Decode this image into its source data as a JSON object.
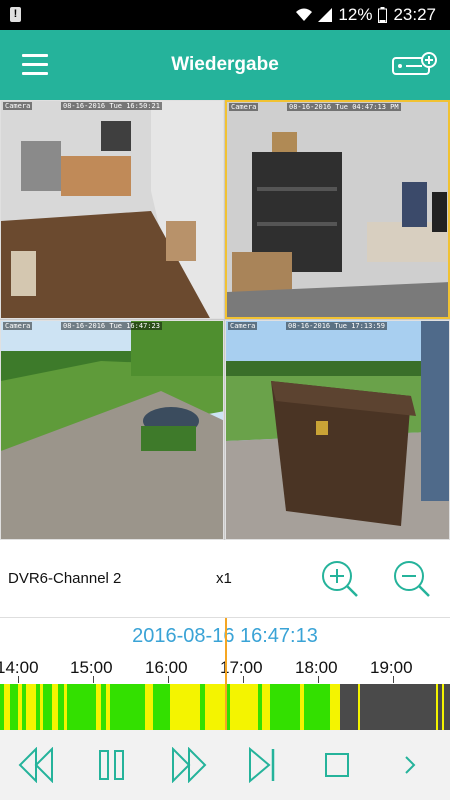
{
  "status_bar": {
    "battery": "12%",
    "time": "23:27"
  },
  "app_bar": {
    "title": "Wiedergabe"
  },
  "cameras": [
    {
      "name": "Camera",
      "timestamp": "08-16-2016 Tue 16:50:21"
    },
    {
      "name": "Camera",
      "timestamp": "08-16-2016 Tue 04:47:13 PM"
    },
    {
      "name": "Camera",
      "timestamp": "08-16-2016 Tue 16:47:23"
    },
    {
      "name": "Camera",
      "timestamp": "08-16-2016 Tue 17:13:59"
    }
  ],
  "playback": {
    "channel": "DVR6-Channel 2",
    "speed": "x1"
  },
  "timeline": {
    "current_time": "2016-08-16 16:47:13",
    "hours": [
      "14:00",
      "15:00",
      "16:00",
      "17:00",
      "18:00",
      "19:00",
      ""
    ],
    "colors": {
      "motion": "#33e000",
      "alarm": "#f4f400",
      "empty": "#4a4a4a",
      "cursor": "#f5a623"
    }
  },
  "colors": {
    "accent": "#25b39b",
    "time_text": "#3aa3d6"
  },
  "icons": {
    "menu": "menu-icon",
    "dvr": "dvr-add-icon",
    "zoom_in": "zoom-in-icon",
    "zoom_out": "zoom-out-icon",
    "rewind": "rewind-icon",
    "pause": "pause-icon",
    "fast_forward": "fast-forward-icon",
    "skip_next": "skip-next-icon",
    "stop": "stop-icon",
    "more": "chevron-right-icon"
  }
}
